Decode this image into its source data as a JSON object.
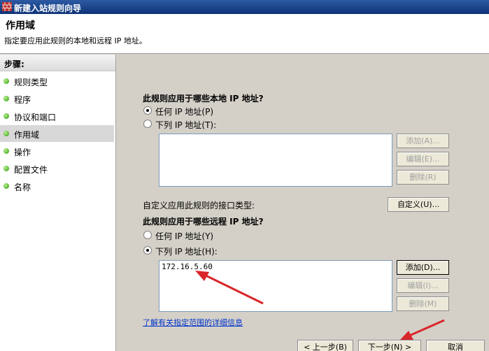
{
  "window": {
    "title": "新建入站规则向导"
  },
  "header": {
    "title": "作用域",
    "subtitle": "指定要应用此规则的本地和远程 IP 地址。"
  },
  "sidebar": {
    "heading": "步骤:",
    "items": [
      {
        "label": "规则类型"
      },
      {
        "label": "程序"
      },
      {
        "label": "协议和端口"
      },
      {
        "label": "作用域"
      },
      {
        "label": "操作"
      },
      {
        "label": "配置文件"
      },
      {
        "label": "名称"
      }
    ],
    "active_index": 3
  },
  "local": {
    "question": "此规则应用于哪些本地 IP 地址?",
    "any_label": "任何 IP 地址(P)",
    "list_label": "下列 IP 地址(T):",
    "selected": "any",
    "add": "添加(A)...",
    "edit": "编辑(E)...",
    "remove": "删除(R)"
  },
  "interface": {
    "label": "自定义应用此规则的接口类型:",
    "button": "自定义(U)..."
  },
  "remote": {
    "question": "此规则应用于哪些远程 IP 地址?",
    "any_label": "任何 IP 地址(Y)",
    "list_label": "下列 IP 地址(H):",
    "selected": "list",
    "addresses": [
      "172.16.5.60"
    ],
    "add": "添加(D)...",
    "edit": "编辑(I)...",
    "remove": "删除(M)"
  },
  "help_link": "了解有关指定范围的详细信息",
  "footer": {
    "back": "< 上一步(B)",
    "next": "下一步(N) >",
    "cancel": "取消"
  },
  "colors": {
    "annotation_arrow": "#d9262a",
    "link": "#0033cc",
    "title_bar": "#0d3277"
  }
}
